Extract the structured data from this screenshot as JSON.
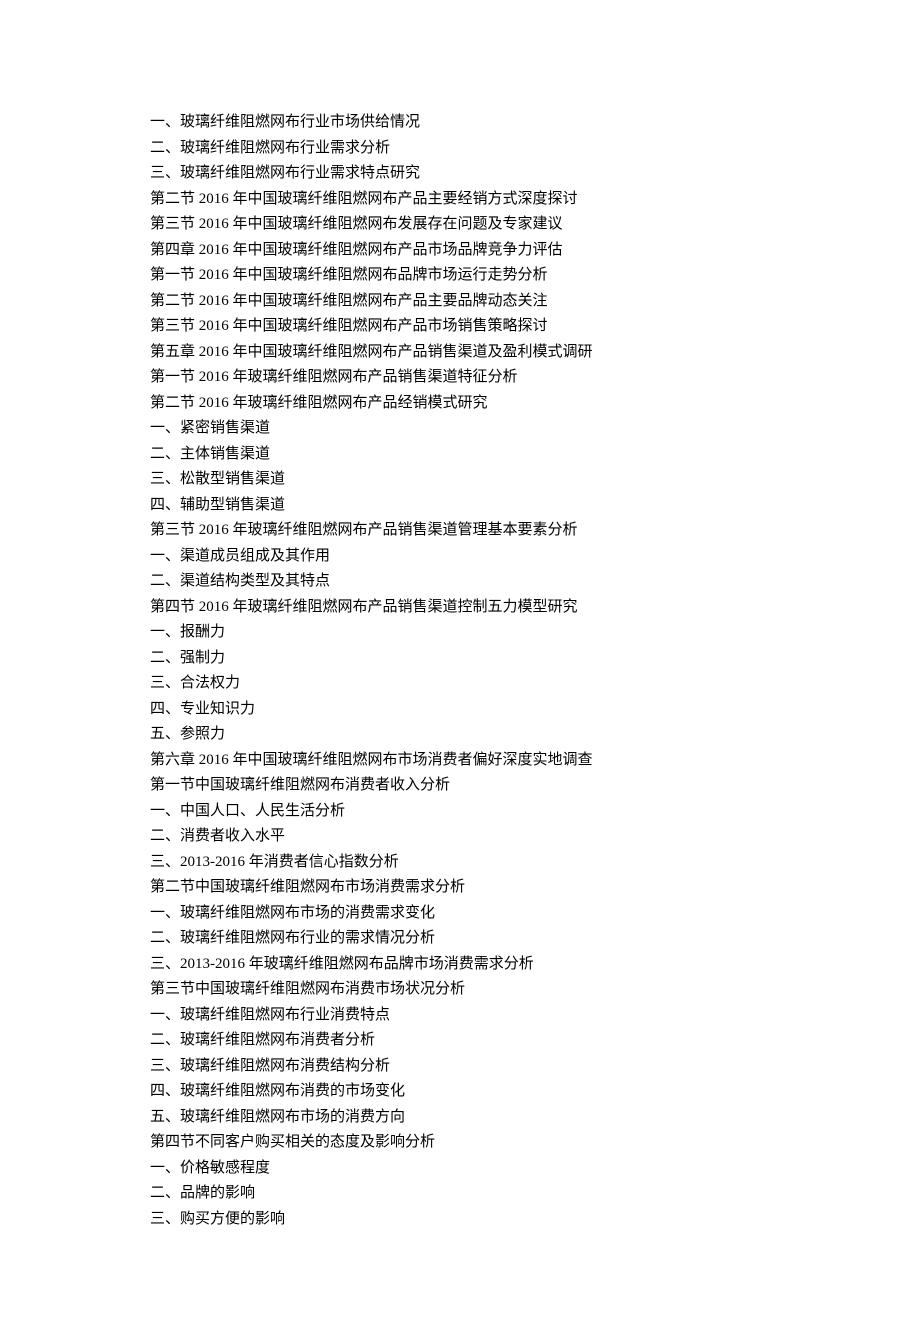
{
  "lines": [
    "一、玻璃纤维阻燃网布行业市场供给情况",
    "二、玻璃纤维阻燃网布行业需求分析",
    "三、玻璃纤维阻燃网布行业需求特点研究",
    "第二节 2016 年中国玻璃纤维阻燃网布产品主要经销方式深度探讨",
    "第三节 2016 年中国玻璃纤维阻燃网布发展存在问题及专家建议",
    "第四章 2016 年中国玻璃纤维阻燃网布产品市场品牌竞争力评估",
    "第一节 2016 年中国玻璃纤维阻燃网布品牌市场运行走势分析",
    "第二节 2016 年中国玻璃纤维阻燃网布产品主要品牌动态关注",
    "第三节 2016 年中国玻璃纤维阻燃网布产品市场销售策略探讨",
    "第五章 2016 年中国玻璃纤维阻燃网布产品销售渠道及盈利模式调研",
    "第一节 2016 年玻璃纤维阻燃网布产品销售渠道特征分析",
    "第二节 2016 年玻璃纤维阻燃网布产品经销模式研究",
    "一、紧密销售渠道",
    "二、主体销售渠道",
    "三、松散型销售渠道",
    "四、辅助型销售渠道",
    "第三节 2016 年玻璃纤维阻燃网布产品销售渠道管理基本要素分析",
    "一、渠道成员组成及其作用",
    "二、渠道结构类型及其特点",
    "第四节 2016 年玻璃纤维阻燃网布产品销售渠道控制五力模型研究",
    "一、报酬力",
    "二、强制力",
    "三、合法权力",
    "四、专业知识力",
    "五、参照力",
    "第六章 2016 年中国玻璃纤维阻燃网布市场消费者偏好深度实地调查",
    "第一节中国玻璃纤维阻燃网布消费者收入分析",
    "一、中国人口、人民生活分析",
    "二、消费者收入水平",
    "三、2013-2016 年消费者信心指数分析",
    "第二节中国玻璃纤维阻燃网布市场消费需求分析",
    "一、玻璃纤维阻燃网布市场的消费需求变化",
    "二、玻璃纤维阻燃网布行业的需求情况分析",
    "三、2013-2016 年玻璃纤维阻燃网布品牌市场消费需求分析",
    "第三节中国玻璃纤维阻燃网布消费市场状况分析",
    "一、玻璃纤维阻燃网布行业消费特点",
    "二、玻璃纤维阻燃网布消费者分析",
    "三、玻璃纤维阻燃网布消费结构分析",
    "四、玻璃纤维阻燃网布消费的市场变化",
    "五、玻璃纤维阻燃网布市场的消费方向",
    "第四节不同客户购买相关的态度及影响分析",
    "一、价格敏感程度",
    "二、品牌的影响",
    "三、购买方便的影响"
  ]
}
